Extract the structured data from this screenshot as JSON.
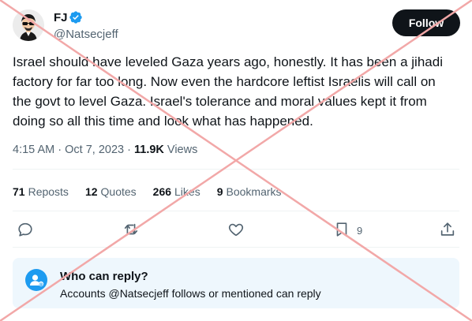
{
  "author": {
    "display_name": "FJ",
    "handle": "@Natsecjeff",
    "verified": true,
    "avatar_icon": "cartoon-avatar"
  },
  "follow_label": "Follow",
  "tweet": {
    "lines": [
      "Israel should have leveled Gaza years ago, honestly. It has been a jihadi",
      "factory for far too long. Now even the hardcore leftist Israelis will call on",
      "the govt to level Gaza. Israel's tolerance and moral values kept it from",
      "doing so all this time and look what has happened."
    ],
    "time": "4:15 AM",
    "separator": "·",
    "date": "Oct 7, 2023",
    "views_count": "11.9K",
    "views_label": "Views"
  },
  "stats": [
    {
      "count": "71",
      "label": "Reposts"
    },
    {
      "count": "12",
      "label": "Quotes"
    },
    {
      "count": "266",
      "label": "Likes"
    },
    {
      "count": "9",
      "label": "Bookmarks"
    }
  ],
  "actions": {
    "bookmark_count": "9",
    "icons": [
      "reply-icon",
      "repost-icon",
      "like-icon",
      "bookmark-icon",
      "share-icon"
    ]
  },
  "reply_settings": {
    "title": "Who can reply?",
    "description": "Accounts @Natsecjeff follows or mentioned can reply"
  },
  "colors": {
    "accent": "#1d9bf0",
    "text_primary": "#0f1419",
    "text_secondary": "#536471",
    "follow_bg": "#0f1419",
    "reply_box_bg": "#eef7fd",
    "cross_overlay": "#f2a8a8"
  }
}
